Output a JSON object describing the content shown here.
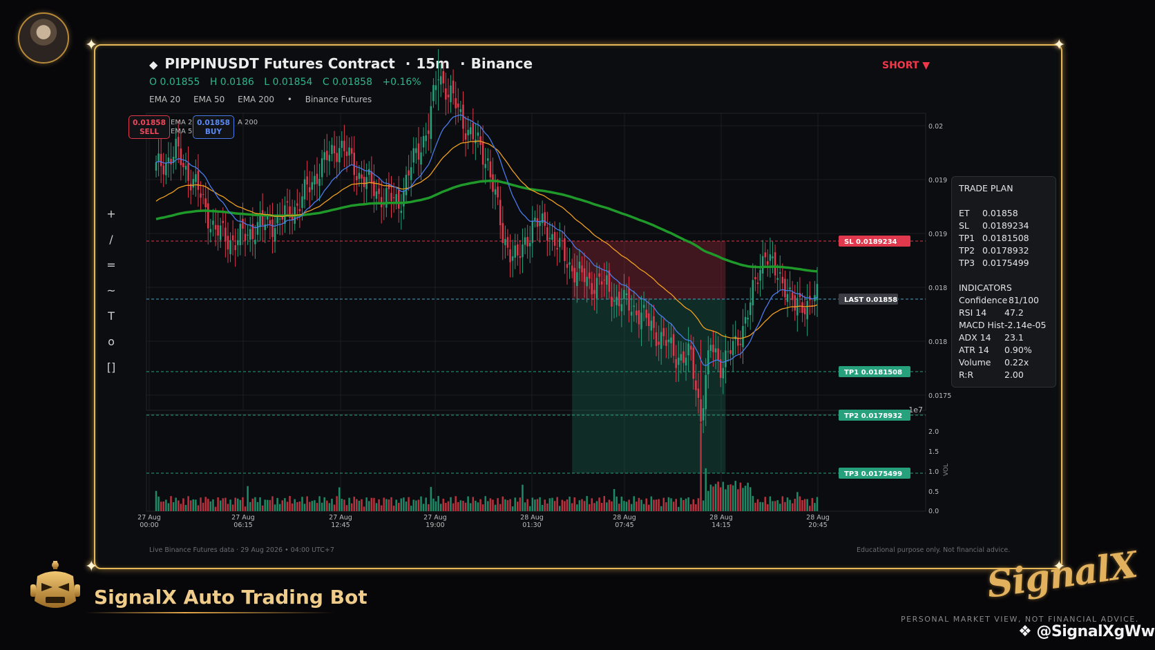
{
  "header": {
    "title": "PIPPINUSDT Futures Contract",
    "interval": "15m",
    "exchange": "Binance",
    "ohlc": {
      "o": "O 0.01855",
      "h": "H 0.0186",
      "l": "L 0.01854",
      "c": "C 0.01858",
      "chg": "+0.16%"
    },
    "indicators": [
      "EMA 20",
      "EMA 50",
      "EMA 200",
      "•",
      "Binance Futures"
    ],
    "direction": "SHORT ▼"
  },
  "price_boxes": {
    "sell": {
      "price": "0.01858",
      "label": "SELL"
    },
    "buy": {
      "price": "0.01858",
      "label": "BUY"
    },
    "legend_fragments": [
      "EMA 2",
      "EMA 5",
      "A 200"
    ]
  },
  "toolbar": [
    "+",
    "/",
    "=",
    "~",
    "T",
    "o",
    "[]"
  ],
  "trade_plan": {
    "heading": "TRADE PLAN",
    "levels": [
      [
        "ET",
        "0.01858"
      ],
      [
        "SL",
        "0.0189234"
      ],
      [
        "TP1",
        "0.0181508"
      ],
      [
        "TP2",
        "0.0178932"
      ],
      [
        "TP3",
        "0.0175499"
      ]
    ],
    "indicators_heading": "INDICATORS",
    "indicators": [
      [
        "Confidence",
        "81/100"
      ],
      [
        "RSI 14",
        "47.2"
      ],
      [
        "MACD Hist",
        "-2.14e-05"
      ],
      [
        "ADX 14",
        "23.1"
      ],
      [
        "ATR 14",
        "0.90%"
      ],
      [
        "Volume",
        "0.22x"
      ],
      [
        "R:R",
        "2.00"
      ]
    ]
  },
  "footer": {
    "left": "Live Binance Futures data  ·  29 Aug 2026 • 04:00 UTC+7",
    "right": "Educational purpose only. Not financial advice."
  },
  "branding": {
    "bot_name": "SignalX Auto Trading Bot",
    "logo": "SignalX",
    "disclaimer": "PERSONAL MARKET VIEW, NOT FINANCIAL ADVICE.",
    "handle": "@SignalXgWw"
  },
  "colors": {
    "up": "#26a17b",
    "down": "#e0394d",
    "ema20": "#4a7bea",
    "ema50": "#f0a020",
    "ema200": "#1f9a2a",
    "frame": "#e7b85a"
  },
  "chart_data": [
    {
      "type": "candlestick",
      "yticks": [
        "0.02",
        "0.019",
        "0.019",
        "0.018",
        "0.018",
        "0.0175"
      ],
      "ylim": [
        0.0174,
        0.0201
      ],
      "offset_label": "1e7",
      "x_labels": [
        [
          "27 Aug",
          "00:00"
        ],
        [
          "27 Aug",
          "06:15"
        ],
        [
          "27 Aug",
          "12:45"
        ],
        [
          "27 Aug",
          "19:00"
        ],
        [
          "28 Aug",
          "01:30"
        ],
        [
          "28 Aug",
          "07:45"
        ],
        [
          "28 Aug",
          "14:15"
        ],
        [
          "28 Aug",
          "20:45"
        ]
      ],
      "levels": [
        {
          "name": "SL",
          "value": 0.0189234,
          "label": "SL  0.0189234",
          "color": "#e0394d"
        },
        {
          "name": "LAST",
          "value": 0.01858,
          "label": "LAST  0.01858",
          "color": "#4aa3c8"
        },
        {
          "name": "TP1",
          "value": 0.0181508,
          "label": "TP1  0.0181508",
          "color": "#26a17b"
        },
        {
          "name": "TP2",
          "value": 0.0178932,
          "label": "TP2  0.0178932",
          "color": "#26a17b"
        },
        {
          "name": "TP3",
          "value": 0.0175499,
          "label": "TP3  0.0175499",
          "color": "#26a17b"
        }
      ],
      "close_anchors": [
        [
          0,
          0.01935
        ],
        [
          8,
          0.01945
        ],
        [
          16,
          0.01925
        ],
        [
          24,
          0.01898
        ],
        [
          32,
          0.01892
        ],
        [
          40,
          0.019
        ],
        [
          50,
          0.01905
        ],
        [
          58,
          0.01915
        ],
        [
          66,
          0.01935
        ],
        [
          74,
          0.0195
        ],
        [
          82,
          0.01932
        ],
        [
          90,
          0.0192
        ],
        [
          98,
          0.01915
        ],
        [
          104,
          0.0194
        ],
        [
          110,
          0.0196
        ],
        [
          114,
          0.01992
        ],
        [
          120,
          0.01975
        ],
        [
          126,
          0.01958
        ],
        [
          134,
          0.0194
        ],
        [
          140,
          0.01895
        ],
        [
          146,
          0.0188
        ],
        [
          152,
          0.01903
        ],
        [
          158,
          0.019
        ],
        [
          166,
          0.0188
        ],
        [
          174,
          0.01868
        ],
        [
          180,
          0.01868
        ],
        [
          186,
          0.01858
        ],
        [
          194,
          0.01852
        ],
        [
          198,
          0.01845
        ],
        [
          204,
          0.01835
        ],
        [
          210,
          0.01825
        ],
        [
          216,
          0.01823
        ],
        [
          220,
          0.0179
        ],
        [
          224,
          0.0183
        ],
        [
          228,
          0.0182
        ],
        [
          234,
          0.0183
        ],
        [
          240,
          0.01855
        ],
        [
          246,
          0.01888
        ],
        [
          250,
          0.01872
        ],
        [
          254,
          0.01868
        ],
        [
          258,
          0.01852
        ],
        [
          262,
          0.01856
        ],
        [
          266,
          0.01858
        ]
      ],
      "volume": {
        "yticks": [
          "2.0",
          "1.5",
          "1.0",
          "0.5",
          "0.0"
        ],
        "ylim": [
          0,
          2.35
        ],
        "ylabel": "VOL",
        "spike_index": 220,
        "spike_value": 2.3
      }
    }
  ]
}
